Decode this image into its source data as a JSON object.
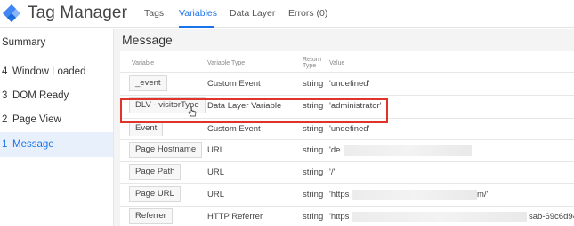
{
  "app": {
    "title": "Tag Manager",
    "logo_icon": "gtm-diamond-icon"
  },
  "nav": {
    "tabs": [
      {
        "label": "Tags",
        "active": false
      },
      {
        "label": "Variables",
        "active": true
      },
      {
        "label": "Data Layer",
        "active": false
      },
      {
        "label": "Errors (0)",
        "active": false
      }
    ]
  },
  "sidebar": {
    "items": [
      {
        "num": "",
        "label": "Summary",
        "active": false
      },
      {
        "num": "4",
        "label": "Window Loaded",
        "active": false
      },
      {
        "num": "3",
        "label": "DOM Ready",
        "active": false
      },
      {
        "num": "2",
        "label": "Page View",
        "active": false
      },
      {
        "num": "1",
        "label": "Message",
        "active": true
      }
    ]
  },
  "main": {
    "title": "Message",
    "headers": {
      "variable": "Variable",
      "type": "Variable Type",
      "return_1": "Return",
      "return_2": "Type",
      "value": "Value"
    },
    "rows": [
      {
        "variable": "_event",
        "type": "Custom Event",
        "return": "string",
        "value": "'undefined'"
      },
      {
        "variable": "DLV - visitorType",
        "type": "Data Layer Variable",
        "return": "string",
        "value": "'administrator'"
      },
      {
        "variable": "Event",
        "type": "Custom Event",
        "return": "string",
        "value": "'undefined'"
      },
      {
        "variable": "Page Hostname",
        "type": "URL",
        "return": "string",
        "value": "'de"
      },
      {
        "variable": "Page Path",
        "type": "URL",
        "return": "string",
        "value": "'/'"
      },
      {
        "variable": "Page URL",
        "type": "URL",
        "return": "string",
        "value": "'https",
        "value_end": "m/'"
      },
      {
        "variable": "Referrer",
        "type": "HTTP Referrer",
        "return": "string",
        "value": "'https",
        "value_end": "sab-69c6d94"
      }
    ]
  },
  "colors": {
    "accent": "#1a73e8",
    "highlight": "#e0342b",
    "panel_bg": "#f4f4f4"
  }
}
